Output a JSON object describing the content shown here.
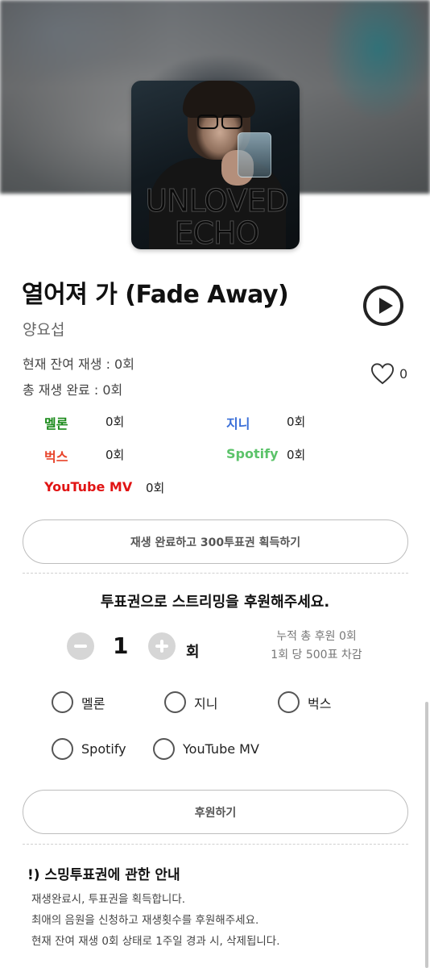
{
  "album": {
    "cover_title_line1": "UNLOVED",
    "cover_title_line2": "ECHO"
  },
  "song": {
    "title": "열어져 가 (Fade Away)",
    "artist": "양요섭"
  },
  "stats": {
    "remaining_plays": "현재 잔여 재생 : 0회",
    "total_completed": "총 재생 완료 : 0회"
  },
  "like": {
    "count": "0",
    "icon": "heart-outline-icon"
  },
  "platforms": [
    {
      "name": "멜론",
      "count": "0회",
      "color": "#1a8a1a"
    },
    {
      "name": "지니",
      "count": "0회",
      "color": "#3a6fd8"
    },
    {
      "name": "벅스",
      "count": "0회",
      "color": "#e8452c"
    },
    {
      "name": "Spotify",
      "count": "0회",
      "color": "#5cc36a"
    },
    {
      "name": "YouTube MV",
      "count": "0회",
      "color": "#e11414"
    }
  ],
  "reward_button": {
    "label": "재생 완료하고 300투표권 획득하기"
  },
  "support": {
    "title": "투표권으로 스트리밍을 후원해주세요.",
    "quantity": "1",
    "unit": "회",
    "total_label": "누적 총 후원 0회",
    "cost_label": "1회 당 500표 차감",
    "options": [
      "멜론",
      "지니",
      "벅스",
      "Spotify",
      "YouTube MV"
    ],
    "submit_label": "후원하기"
  },
  "notice": {
    "title": "!) 스밍투표권에 관한 안내",
    "lines": [
      "재생완료시, 투표권을 획득합니다.",
      "최애의 음원을 신청하고 재생횟수를 후원해주세요.",
      "현재 잔여 재생 0회 상태로 1주일 경과 시, 삭제됩니다."
    ]
  }
}
